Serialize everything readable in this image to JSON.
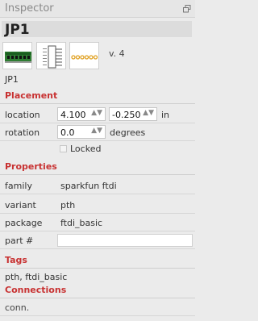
{
  "panel": {
    "title": "Inspector"
  },
  "part": {
    "title": "JP1",
    "version": "v. 4",
    "label": "JP1"
  },
  "placement": {
    "heading": "Placement",
    "location_label": "location",
    "location_x": "4.100",
    "location_y": "-0.250",
    "location_unit": "in",
    "rotation_label": "rotation",
    "rotation_value": "0.0",
    "rotation_unit": "degrees",
    "locked_label": "Locked"
  },
  "properties": {
    "heading": "Properties",
    "rows": [
      {
        "label": "family",
        "value": "sparkfun ftdi"
      },
      {
        "label": "variant",
        "value": "pth"
      },
      {
        "label": "package",
        "value": "ftdi_basic"
      }
    ],
    "part_number_label": "part #",
    "part_number_value": ""
  },
  "tags": {
    "heading": "Tags",
    "value": "pth, ftdi_basic"
  },
  "connections": {
    "heading": "Connections",
    "conn_label": "conn."
  },
  "icons": [
    "float-window-icon",
    "breadboard-view-thumbnail",
    "schematic-view-thumbnail",
    "pcb-view-thumbnail",
    "spin-arrows-icon"
  ],
  "colors": {
    "section_heading": "#c83232",
    "pcb_green": "#2e7d32",
    "pad_gold": "#e0a020"
  }
}
